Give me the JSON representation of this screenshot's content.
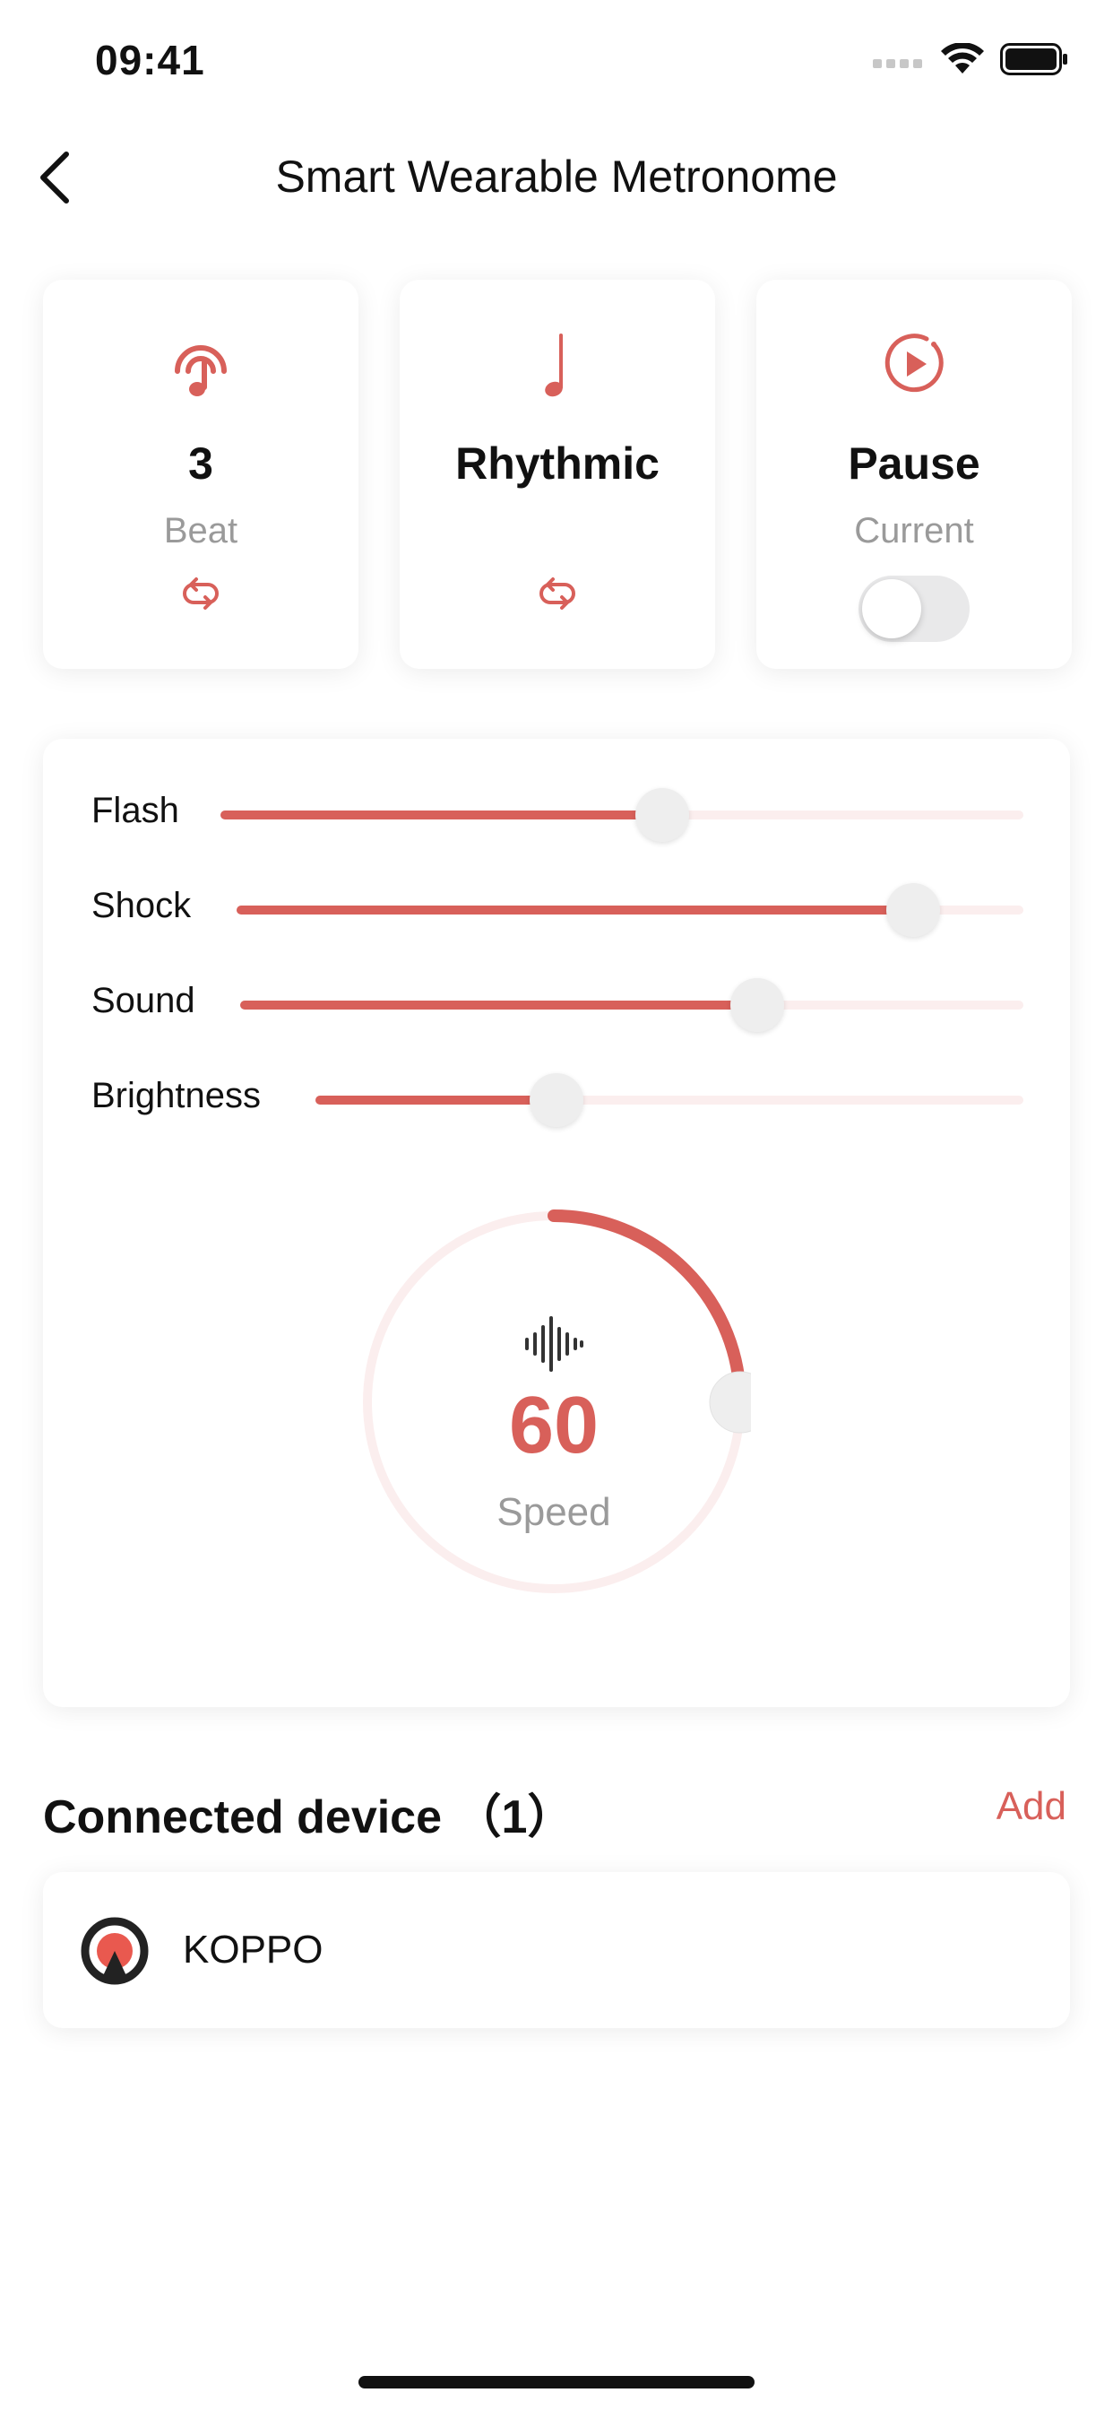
{
  "status_bar": {
    "time": "09:41"
  },
  "nav": {
    "title": "Smart Wearable Metronome",
    "back_icon": "chevron-left-icon"
  },
  "modes": [
    {
      "value": "3",
      "caption": "Beat",
      "icon": "headphone-note-icon",
      "action_icon": "cycle-icon"
    },
    {
      "value": "Rhythmic",
      "caption": "",
      "icon": "music-note-icon",
      "action_icon": "cycle-icon"
    },
    {
      "value": "Pause",
      "caption": "Current",
      "icon": "play-circle-icon",
      "toggle_on": false
    }
  ],
  "sliders": [
    {
      "label": "Flash",
      "value": 0.55
    },
    {
      "label": "Shock",
      "value": 0.86
    },
    {
      "label": "Sound",
      "value": 0.66
    },
    {
      "label": "Brightness",
      "value": 0.34
    }
  ],
  "speed": {
    "value": "60",
    "caption": "Speed",
    "fraction": 0.25,
    "icon": "sound-wave-icon"
  },
  "devices_section": {
    "title": "Connected device （1）",
    "add_label": "Add"
  },
  "devices": [
    {
      "name": "KOPPO",
      "icon": "koppo-logo-icon"
    }
  ],
  "colors": {
    "accent": "#d8605a",
    "track": "#fbeeee",
    "muted": "#9a9a9a"
  }
}
